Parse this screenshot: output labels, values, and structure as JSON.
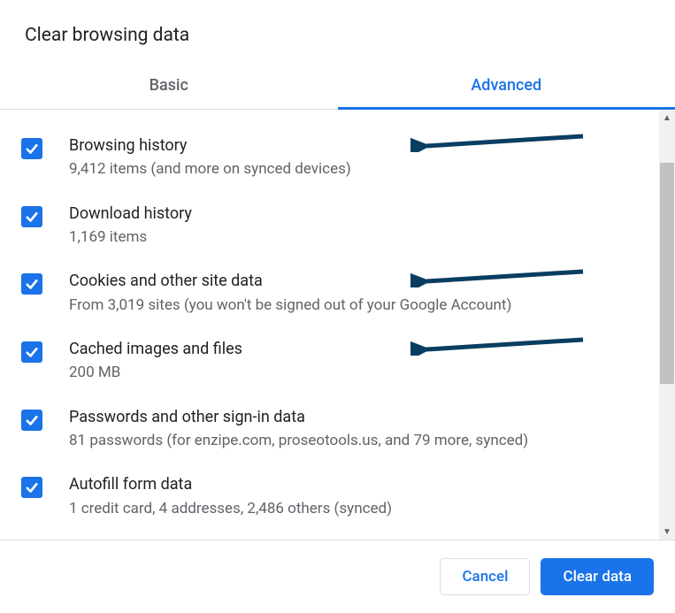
{
  "title": "Clear browsing data",
  "tabs": {
    "basic": "Basic",
    "advanced": "Advanced"
  },
  "items": [
    {
      "title": "Browsing history",
      "sub": "9,412 items (and more on synced devices)",
      "checked": true,
      "arrow": true
    },
    {
      "title": "Download history",
      "sub": "1,169 items",
      "checked": true,
      "arrow": false
    },
    {
      "title": "Cookies and other site data",
      "sub": "From 3,019 sites (you won't be signed out of your Google Account)",
      "checked": true,
      "arrow": true
    },
    {
      "title": "Cached images and files",
      "sub": "200 MB",
      "checked": true,
      "arrow": true
    },
    {
      "title": "Passwords and other sign-in data",
      "sub": "81 passwords (for enzipe.com, proseotools.us, and 79 more, synced)",
      "checked": true,
      "arrow": false
    },
    {
      "title": "Autofill form data",
      "sub": "1 credit card, 4 addresses, 2,486 others (synced)",
      "checked": true,
      "arrow": false
    }
  ],
  "buttons": {
    "cancel": "Cancel",
    "clear": "Clear data"
  }
}
